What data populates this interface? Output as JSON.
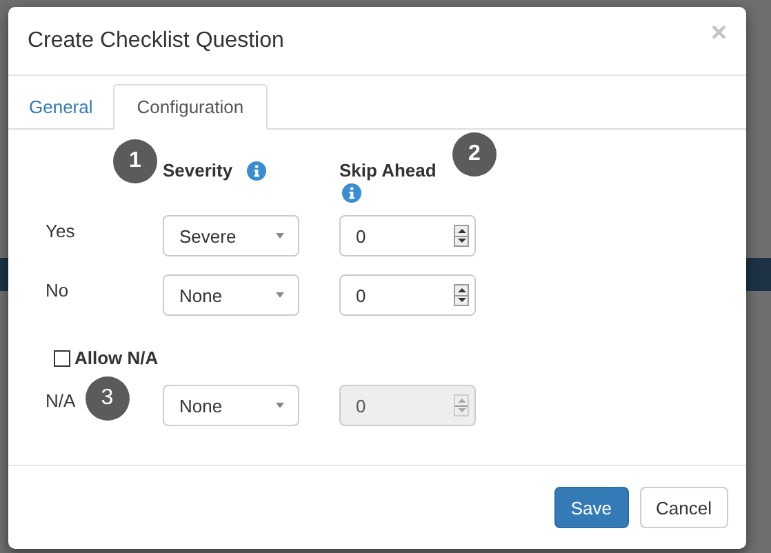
{
  "dialog": {
    "title": "Create Checklist Question",
    "close": "×"
  },
  "tabs": [
    {
      "label": "General",
      "selected": false
    },
    {
      "label": "Configuration",
      "selected": true
    }
  ],
  "columns": [
    {
      "label": "Severity",
      "badge": "1"
    },
    {
      "label": "Skip Ahead",
      "badge": "2"
    }
  ],
  "rows": [
    {
      "label": "Yes",
      "severity": "Severe",
      "skip": "0",
      "disabled": false
    },
    {
      "label": "No",
      "severity": "None",
      "skip": "0",
      "disabled": false
    }
  ],
  "allow_na": {
    "label": "Allow N/A",
    "checked": false
  },
  "na_row": {
    "label": "N/A",
    "badge": "3",
    "severity": "None",
    "skip": "0",
    "disabled": true
  },
  "buttons": [
    {
      "label": "Save",
      "kind": "primary"
    },
    {
      "label": "Cancel",
      "kind": "default"
    }
  ]
}
